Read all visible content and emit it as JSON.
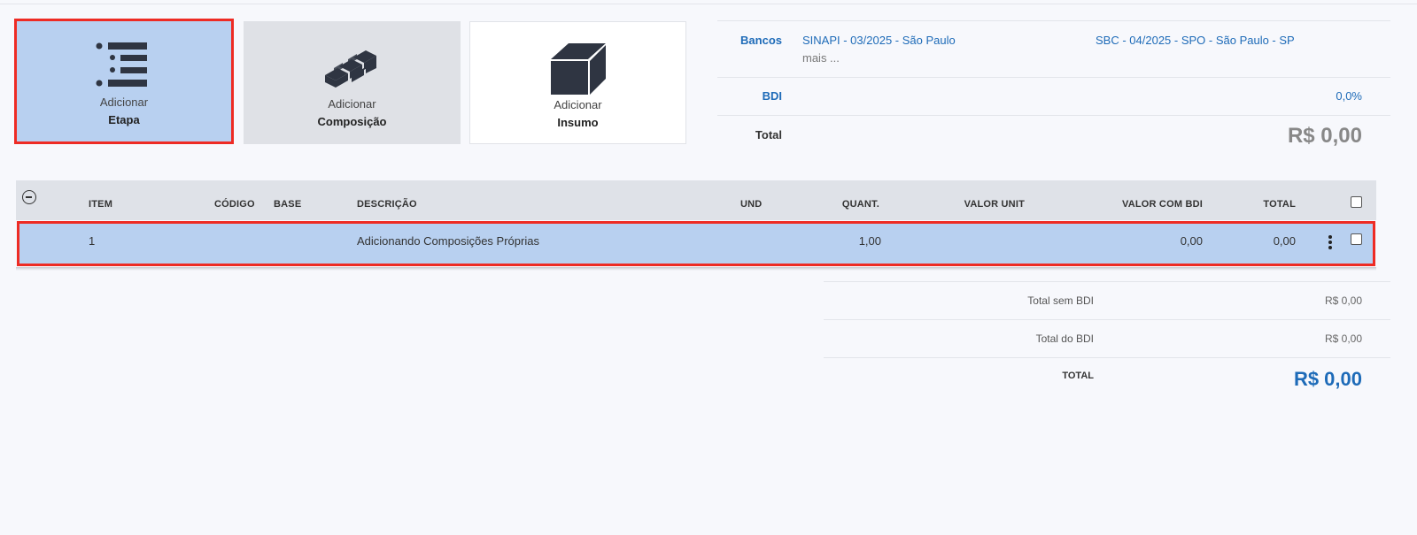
{
  "actions": {
    "etapa": {
      "line1": "Adicionar",
      "line2": "Etapa",
      "icon": "list-indent-icon"
    },
    "composicao": {
      "line1": "Adicionar",
      "line2": "Composição",
      "icon": "brick-wall-icon"
    },
    "insumo": {
      "line1": "Adicionar",
      "line2": "Insumo",
      "icon": "block-icon"
    }
  },
  "summary": {
    "bancos_label": "Bancos",
    "banco1": "SINAPI - 03/2025 - São Paulo",
    "banco2": "SBC - 04/2025 - SPO - São Paulo - SP",
    "mais": "mais ...",
    "bdi_label": "BDI",
    "bdi_value": "0,0%",
    "total_label": "Total",
    "total_value": "R$ 0,00"
  },
  "table": {
    "columns": {
      "item": "ITEM",
      "codigo": "CÓDIGO",
      "base": "BASE",
      "descricao": "DESCRIÇÃO",
      "und": "UND",
      "quant": "QUANT.",
      "valor_unit": "VALOR UNIT",
      "valor_bdi": "VALOR COM BDI",
      "total": "TOTAL"
    },
    "rows": [
      {
        "item": "1",
        "codigo": "",
        "base": "",
        "descricao": "Adicionando Composições Próprias",
        "und": "",
        "quant": "1,00",
        "valor_unit": "",
        "valor_bdi": "0,00",
        "total": "0,00"
      }
    ]
  },
  "totals": {
    "sem_bdi_label": "Total sem BDI",
    "sem_bdi_value": "R$ 0,00",
    "do_bdi_label": "Total do BDI",
    "do_bdi_value": "R$ 0,00",
    "total_label": "TOTAL",
    "total_value": "R$ 0,00"
  },
  "colors": {
    "accent": "#1e6bb8",
    "highlight_border": "#ee2b24",
    "selected_bg": "#b8d0f0"
  }
}
